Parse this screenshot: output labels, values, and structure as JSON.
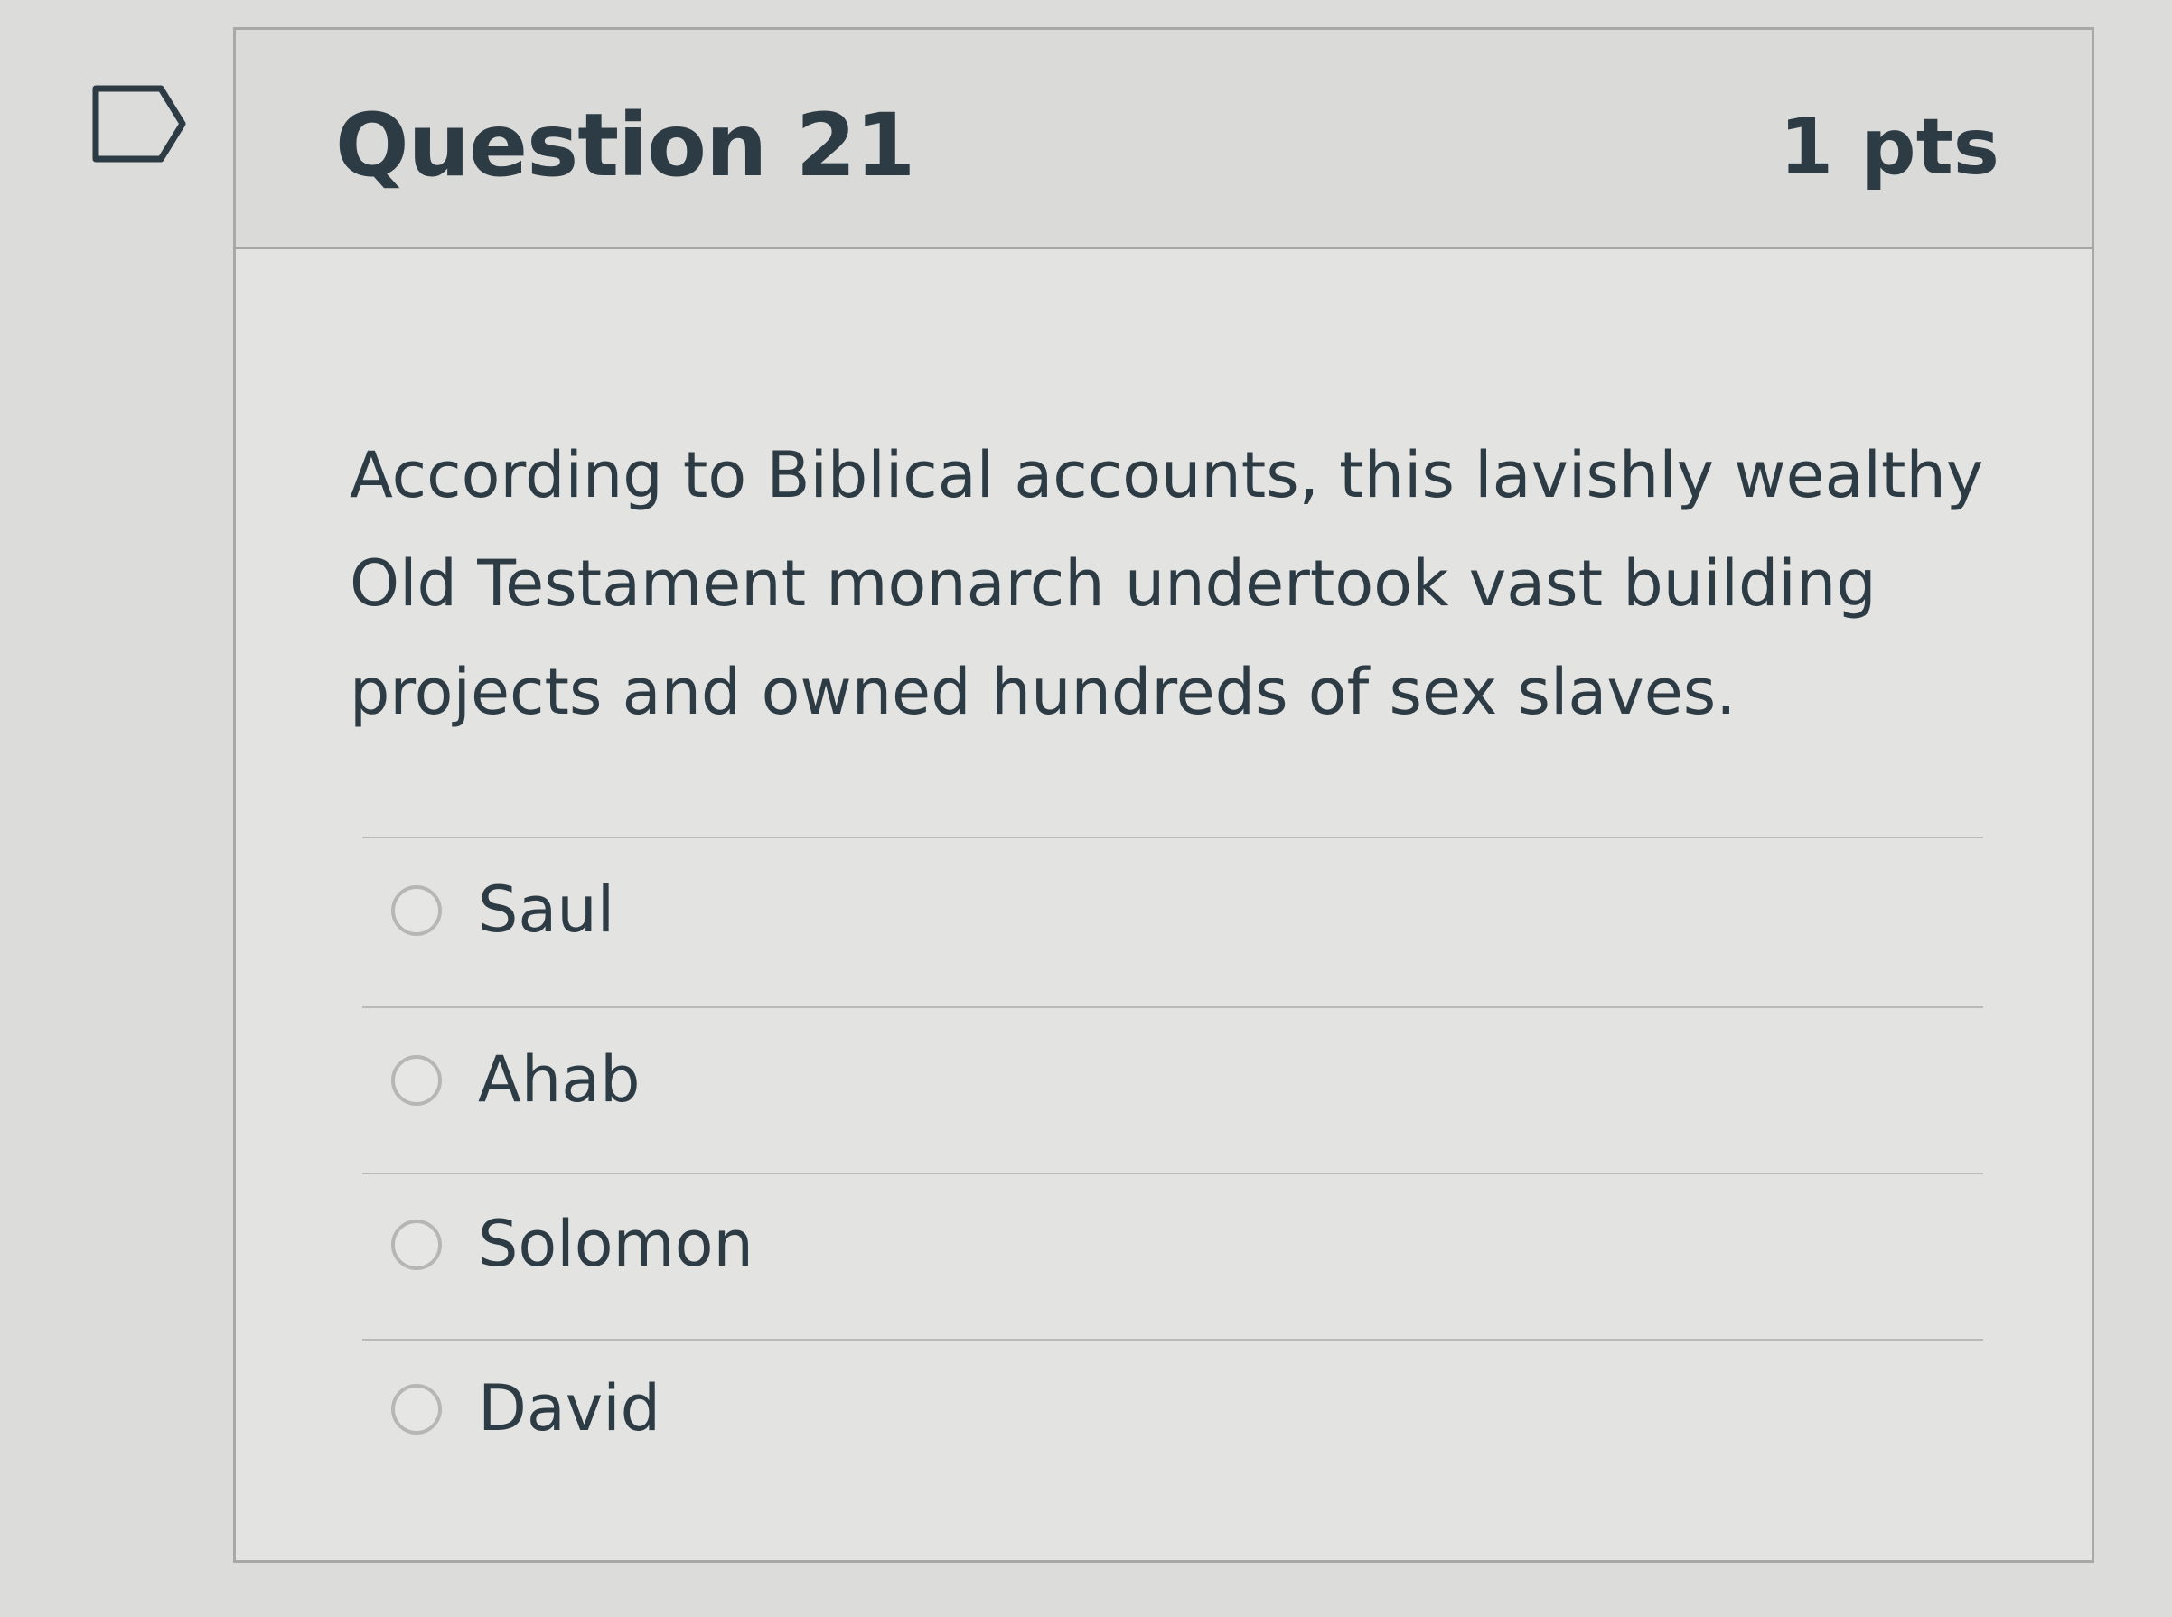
{
  "question": {
    "title": "Question 21",
    "points": "1 pts",
    "text": "According to Biblical accounts, this lavishly wealthy Old Testament monarch undertook vast building projects and owned hundreds of sex slaves."
  },
  "answers": [
    {
      "label": "Saul",
      "selected": false
    },
    {
      "label": "Ahab",
      "selected": false
    },
    {
      "label": "Solomon",
      "selected": false
    },
    {
      "label": "David",
      "selected": false
    }
  ],
  "icons": {
    "flag": "flag-outline-icon"
  },
  "colors": {
    "text": "#2d3b45",
    "header_bg": "#dadad8",
    "card_bg": "#e3e3e1",
    "border": "#a8a8a6"
  }
}
